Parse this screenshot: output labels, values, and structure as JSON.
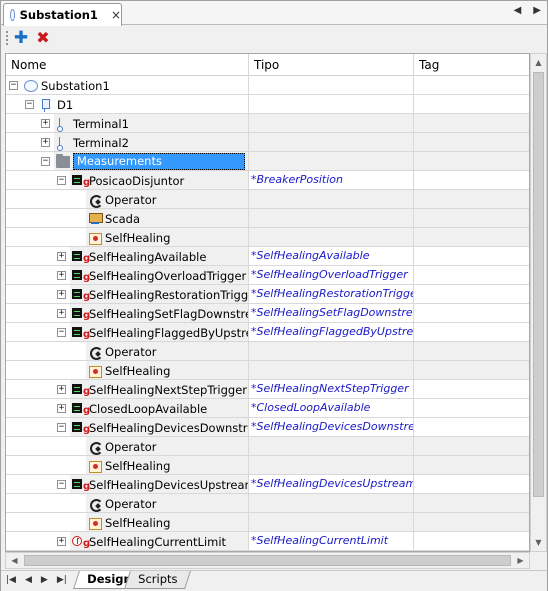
{
  "document_tab": {
    "title": "Substation1",
    "close": "×"
  },
  "nav": {
    "prev": "◀",
    "next": "▶"
  },
  "toolbar": {
    "add_icon": "plus-icon",
    "add_label": "✚",
    "delete_icon": "delete-x-icon",
    "delete_label": "✖"
  },
  "grid": {
    "columns": [
      "Nome",
      "Tipo",
      "Tag"
    ],
    "rows": [
      {
        "depth": 0,
        "expander": "⊟",
        "icon": "substation",
        "name": "Substation1",
        "tipo": "",
        "gray": false
      },
      {
        "depth": 1,
        "expander": "⊟",
        "icon": "device",
        "name": "D1",
        "tipo": "",
        "gray": false
      },
      {
        "depth": 2,
        "expander": "⊞",
        "icon": "terminal",
        "name": "Terminal1",
        "tipo": "",
        "gray": true
      },
      {
        "depth": 2,
        "expander": "⊞",
        "icon": "terminal",
        "name": "Terminal2",
        "tipo": "",
        "gray": true
      },
      {
        "depth": 2,
        "expander": "⊟",
        "icon": "folder",
        "name": "Measurements",
        "tipo": "",
        "gray": true,
        "selected": true
      },
      {
        "depth": 3,
        "expander": "⊟",
        "icon": "measurement",
        "name": "PosicaoDisjuntor",
        "tipo": "*BreakerPosition",
        "gray": true
      },
      {
        "depth": 4,
        "expander": "",
        "icon": "operator",
        "name": "Operator",
        "tipo": "",
        "gray": true
      },
      {
        "depth": 4,
        "expander": "",
        "icon": "scada",
        "name": "Scada",
        "tipo": "",
        "gray": true
      },
      {
        "depth": 4,
        "expander": "",
        "icon": "selfhealing",
        "name": "SelfHealing",
        "tipo": "",
        "gray": true
      },
      {
        "depth": 3,
        "expander": "⊞",
        "icon": "measurement",
        "name": "SelfHealingAvailable",
        "tipo": "*SelfHealingAvailable",
        "gray": true
      },
      {
        "depth": 3,
        "expander": "⊞",
        "icon": "measurement",
        "name": "SelfHealingOverloadTrigger",
        "tipo": "*SelfHealingOverloadTrigger",
        "gray": true
      },
      {
        "depth": 3,
        "expander": "⊞",
        "icon": "measurement",
        "name": "SelfHealingRestorationTrigger",
        "tipo": "*SelfHealingRestorationTrigger",
        "gray": true
      },
      {
        "depth": 3,
        "expander": "⊞",
        "icon": "measurement",
        "name": "SelfHealingSetFlagDownstream",
        "tipo": "*SelfHealingSetFlagDownstream",
        "gray": true
      },
      {
        "depth": 3,
        "expander": "⊟",
        "icon": "measurement",
        "name": "SelfHealingFlaggedByUpstream",
        "tipo": "*SelfHealingFlaggedByUpstream",
        "gray": true
      },
      {
        "depth": 4,
        "expander": "",
        "icon": "operator",
        "name": "Operator",
        "tipo": "",
        "gray": true
      },
      {
        "depth": 4,
        "expander": "",
        "icon": "selfhealing",
        "name": "SelfHealing",
        "tipo": "",
        "gray": true
      },
      {
        "depth": 3,
        "expander": "⊞",
        "icon": "measurement",
        "name": "SelfHealingNextStepTrigger",
        "tipo": "*SelfHealingNextStepTrigger",
        "gray": true
      },
      {
        "depth": 3,
        "expander": "⊞",
        "icon": "measurement",
        "name": "ClosedLoopAvailable",
        "tipo": "*ClosedLoopAvailable",
        "gray": true
      },
      {
        "depth": 3,
        "expander": "⊟",
        "icon": "measurement",
        "name": "SelfHealingDevicesDownstream",
        "tipo": "*SelfHealingDevicesDownstream",
        "gray": true
      },
      {
        "depth": 4,
        "expander": "",
        "icon": "operator",
        "name": "Operator",
        "tipo": "",
        "gray": true
      },
      {
        "depth": 4,
        "expander": "",
        "icon": "selfhealing",
        "name": "SelfHealing",
        "tipo": "",
        "gray": true
      },
      {
        "depth": 3,
        "expander": "⊟",
        "icon": "measurement",
        "name": "SelfHealingDevicesUpstream",
        "tipo": "*SelfHealingDevicesUpstream",
        "gray": true
      },
      {
        "depth": 4,
        "expander": "",
        "icon": "operator",
        "name": "Operator",
        "tipo": "",
        "gray": true
      },
      {
        "depth": 4,
        "expander": "",
        "icon": "selfhealing",
        "name": "SelfHealing",
        "tipo": "",
        "gray": true
      },
      {
        "depth": 3,
        "expander": "⊞",
        "icon": "measurement-analog",
        "name": "SelfHealingCurrentLimit",
        "tipo": "*SelfHealingCurrentLimit",
        "gray": true
      }
    ]
  },
  "measurement_icon_suffix": "g",
  "scrollbars": {
    "up": "▲",
    "down": "▼",
    "left": "◀",
    "right": "▶"
  },
  "bottom_nav": [
    "|◀",
    "◀",
    "▶",
    "▶|"
  ],
  "bottom_tabs": [
    {
      "label": "Design",
      "active": true
    },
    {
      "label": "Scripts",
      "active": false
    }
  ]
}
